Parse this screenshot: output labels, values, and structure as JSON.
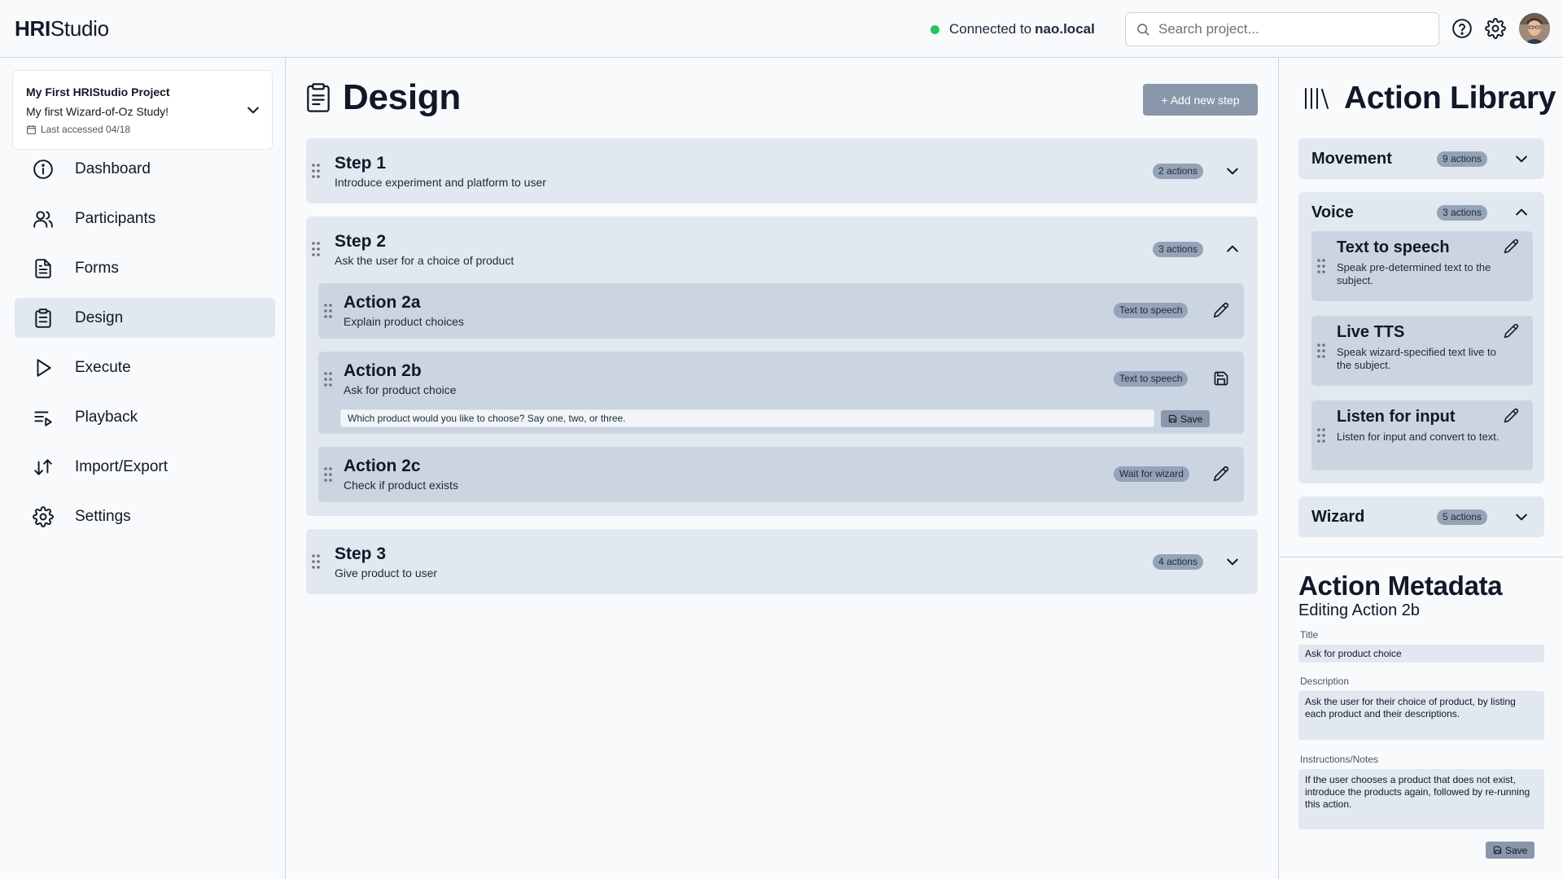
{
  "app": {
    "brand_bold": "HRI",
    "brand_rest": "Studio"
  },
  "topbar": {
    "connection_prefix": "Connected to",
    "connection_host": "nao.local",
    "connection_status_color": "#22c55e",
    "search_placeholder": "Search project...",
    "icons": [
      "help-circle-icon",
      "gear-icon",
      "user-avatar"
    ]
  },
  "project": {
    "name": "My First HRIStudio Project",
    "study": "My first Wizard-of-Oz Study!",
    "last_accessed": "Last accessed 04/18"
  },
  "sidebar": {
    "items": [
      {
        "label": "Dashboard",
        "icon": "info-icon"
      },
      {
        "label": "Participants",
        "icon": "users-icon"
      },
      {
        "label": "Forms",
        "icon": "file-text-icon"
      },
      {
        "label": "Design",
        "icon": "clipboard-icon",
        "active": true
      },
      {
        "label": "Execute",
        "icon": "play-icon"
      },
      {
        "label": "Playback",
        "icon": "list-play-icon"
      },
      {
        "label": "Import/Export",
        "icon": "arrows-up-down-icon"
      },
      {
        "label": "Settings",
        "icon": "gear-icon"
      }
    ]
  },
  "main": {
    "title": "Design",
    "add_step_label": "+ Add new step",
    "steps": [
      {
        "title": "Step 1",
        "description": "Introduce experiment and platform to user",
        "count": "2 actions",
        "expanded": false
      },
      {
        "title": "Step 2",
        "description": "Ask the user for a choice of product",
        "count": "3 actions",
        "expanded": true,
        "actions": [
          {
            "title": "Action 2a",
            "description": "Explain product choices",
            "type": "Text to speech"
          },
          {
            "title": "Action 2b",
            "description": "Ask for product choice",
            "type": "Text to speech",
            "editing": true,
            "input_value": "Which product would you like to choose? Say one, two, or three.",
            "save_label": "Save"
          },
          {
            "title": "Action 2c",
            "description": "Check if product exists",
            "type": "Wait for wizard"
          }
        ]
      },
      {
        "title": "Step 3",
        "description": "Give product to user",
        "count": "4 actions",
        "expanded": false
      }
    ]
  },
  "library": {
    "title": "Action Library",
    "categories": [
      {
        "name": "Movement",
        "count": "9 actions",
        "expanded": false
      },
      {
        "name": "Voice",
        "count": "3 actions",
        "expanded": true,
        "items": [
          {
            "name": "Text to speech",
            "description": "Speak pre-determined text to the subject."
          },
          {
            "name": "Live TTS",
            "description": "Speak wizard-specified text live to the subject."
          },
          {
            "name": "Listen for input",
            "description": "Listen for input and convert to text."
          }
        ]
      },
      {
        "name": "Wizard",
        "count": "5 actions",
        "expanded": false
      }
    ]
  },
  "metadata": {
    "title": "Action Metadata",
    "subtitle": "Editing Action 2b",
    "title_label": "Title",
    "title_value": "Ask for product choice",
    "description_label": "Description",
    "description_value": "Ask the user for their choice of product, by listing each product and their descriptions.",
    "notes_label": "Instructions/Notes",
    "notes_value": "If the user chooses a product that does not exist, introduce the products again, followed by re-running this action.",
    "save_label": "Save"
  }
}
